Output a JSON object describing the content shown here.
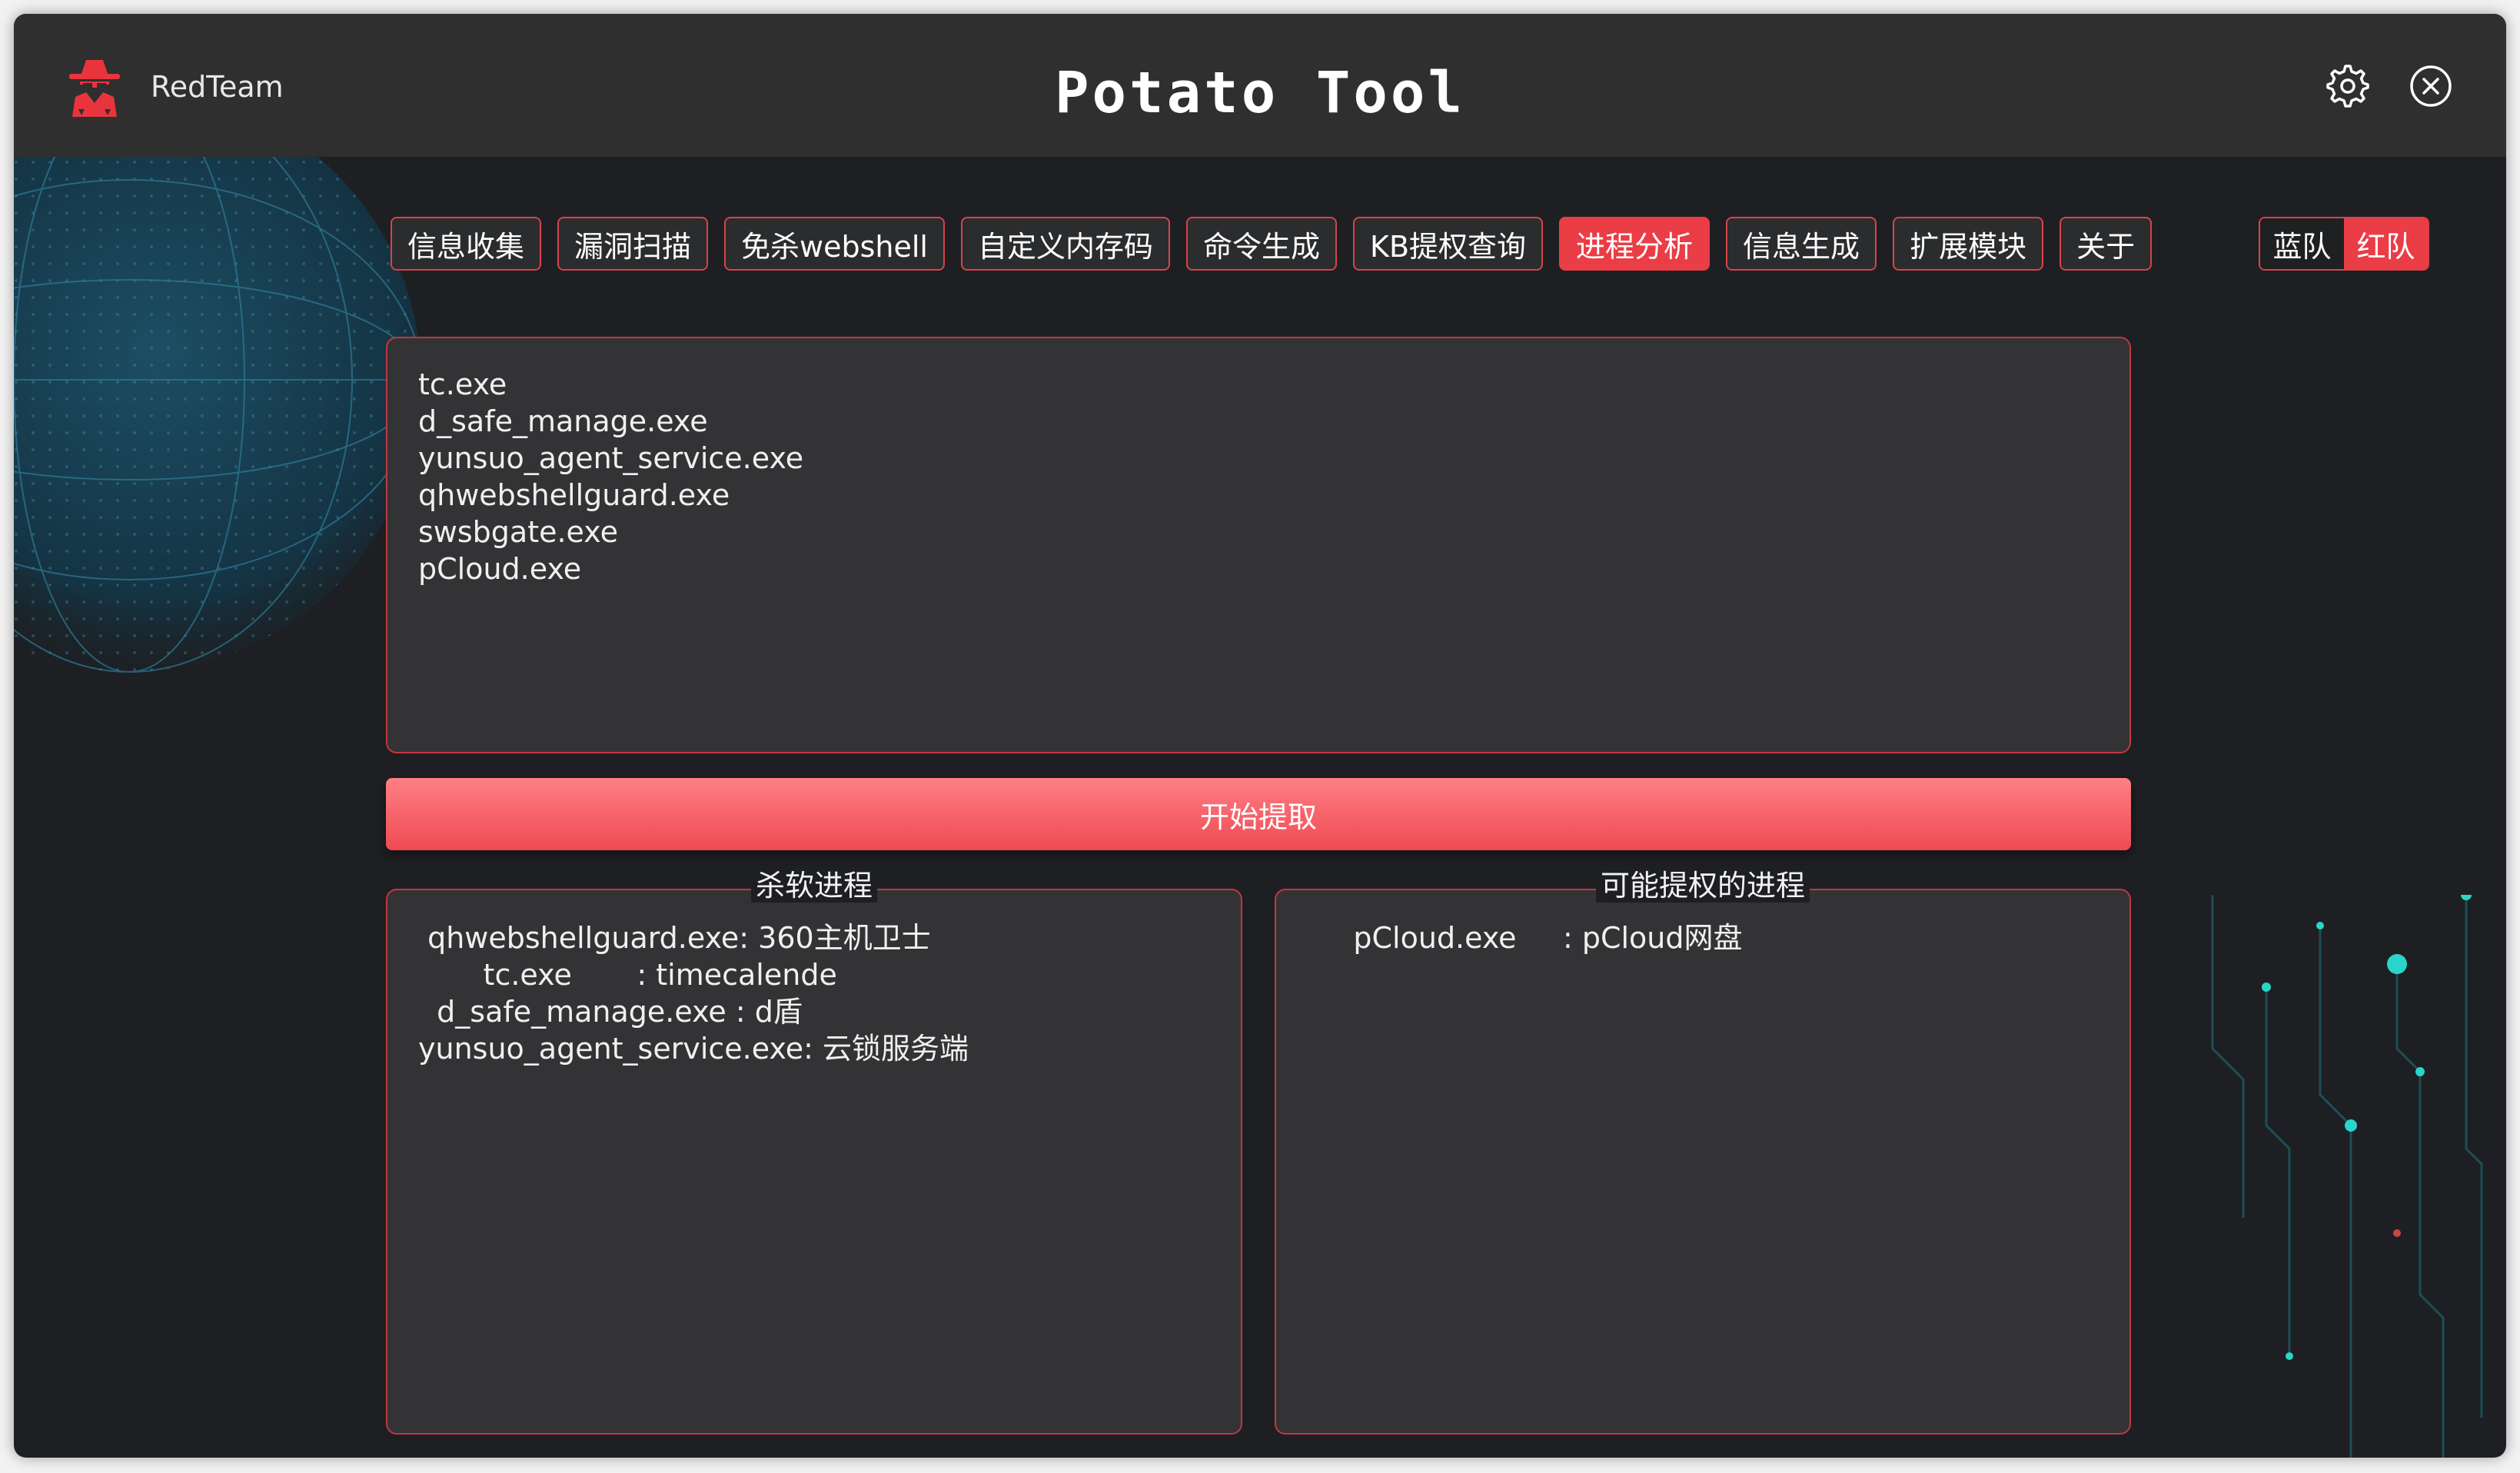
{
  "window": {
    "brand_name": "RedTeam",
    "title": "Potato Tool"
  },
  "tabs": [
    {
      "label": "信息收集",
      "active": false
    },
    {
      "label": "漏洞扫描",
      "active": false
    },
    {
      "label": "免杀webshell",
      "active": false
    },
    {
      "label": "自定义内存码",
      "active": false
    },
    {
      "label": "命令生成",
      "active": false
    },
    {
      "label": "KB提权查询",
      "active": false
    },
    {
      "label": "进程分析",
      "active": true
    },
    {
      "label": "信息生成",
      "active": false
    },
    {
      "label": "扩展模块",
      "active": false
    },
    {
      "label": "关于",
      "active": false
    }
  ],
  "team_toggle": {
    "options": [
      "蓝队",
      "红队"
    ],
    "selected": "红队"
  },
  "process_input": {
    "lines": [
      "tc.exe",
      "d_safe_manage.exe",
      "yunsuo_agent_service.exe",
      "qhwebshellguard.exe",
      "swsbgate.exe",
      "pCloud.exe"
    ]
  },
  "start_button": "开始提取",
  "av_processes": {
    "title": "杀软进程",
    "lines": [
      " qhwebshellguard.exe: 360主机卫士",
      "       tc.exe       : timecalende",
      "  d_safe_manage.exe : d盾",
      "yunsuo_agent_service.exe: 云锁服务端"
    ]
  },
  "privesc_processes": {
    "title": "可能提权的进程",
    "lines": [
      "     pCloud.exe     : pCloud网盘"
    ]
  },
  "colors": {
    "accent": "#ea3d46",
    "border": "#c2373e",
    "panel": "#333335",
    "titlebar": "#2f2f2f"
  },
  "icons": {
    "brand": "hacker-hat-icon",
    "settings": "gear-icon",
    "close": "close-circle-icon"
  }
}
